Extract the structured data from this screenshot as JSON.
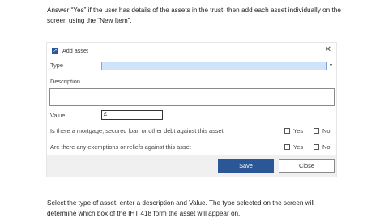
{
  "instructions": {
    "top_line1": "Answer “Yes” if the user has details of the assets in the trust, then add each asset individually on the",
    "top_line2": "screen using the “New Item”.",
    "bottom_line1": "Select the type of asset, enter a description and Value. The type selected on the screen will",
    "bottom_line2": "determine which box of the IHT 418 form the asset will appear on."
  },
  "dialog": {
    "title": "Add asset",
    "close_glyph": "✕",
    "type_label": "Type",
    "type_value": "",
    "description_label": "Description",
    "value_label": "Value",
    "value_prefix": "£",
    "mortgage_question": "Is there a mortgage, secured loan or other debt against this asset",
    "exemption_question": "Are there any exemptions or reliefs against this asset",
    "yes_label": "Yes",
    "no_label": "No",
    "save_label": "Save",
    "close_label": "Close"
  },
  "colors": {
    "accent": "#2b5797",
    "select_highlight": "#cfe3fb",
    "footer_bg": "#f0f0f0"
  }
}
